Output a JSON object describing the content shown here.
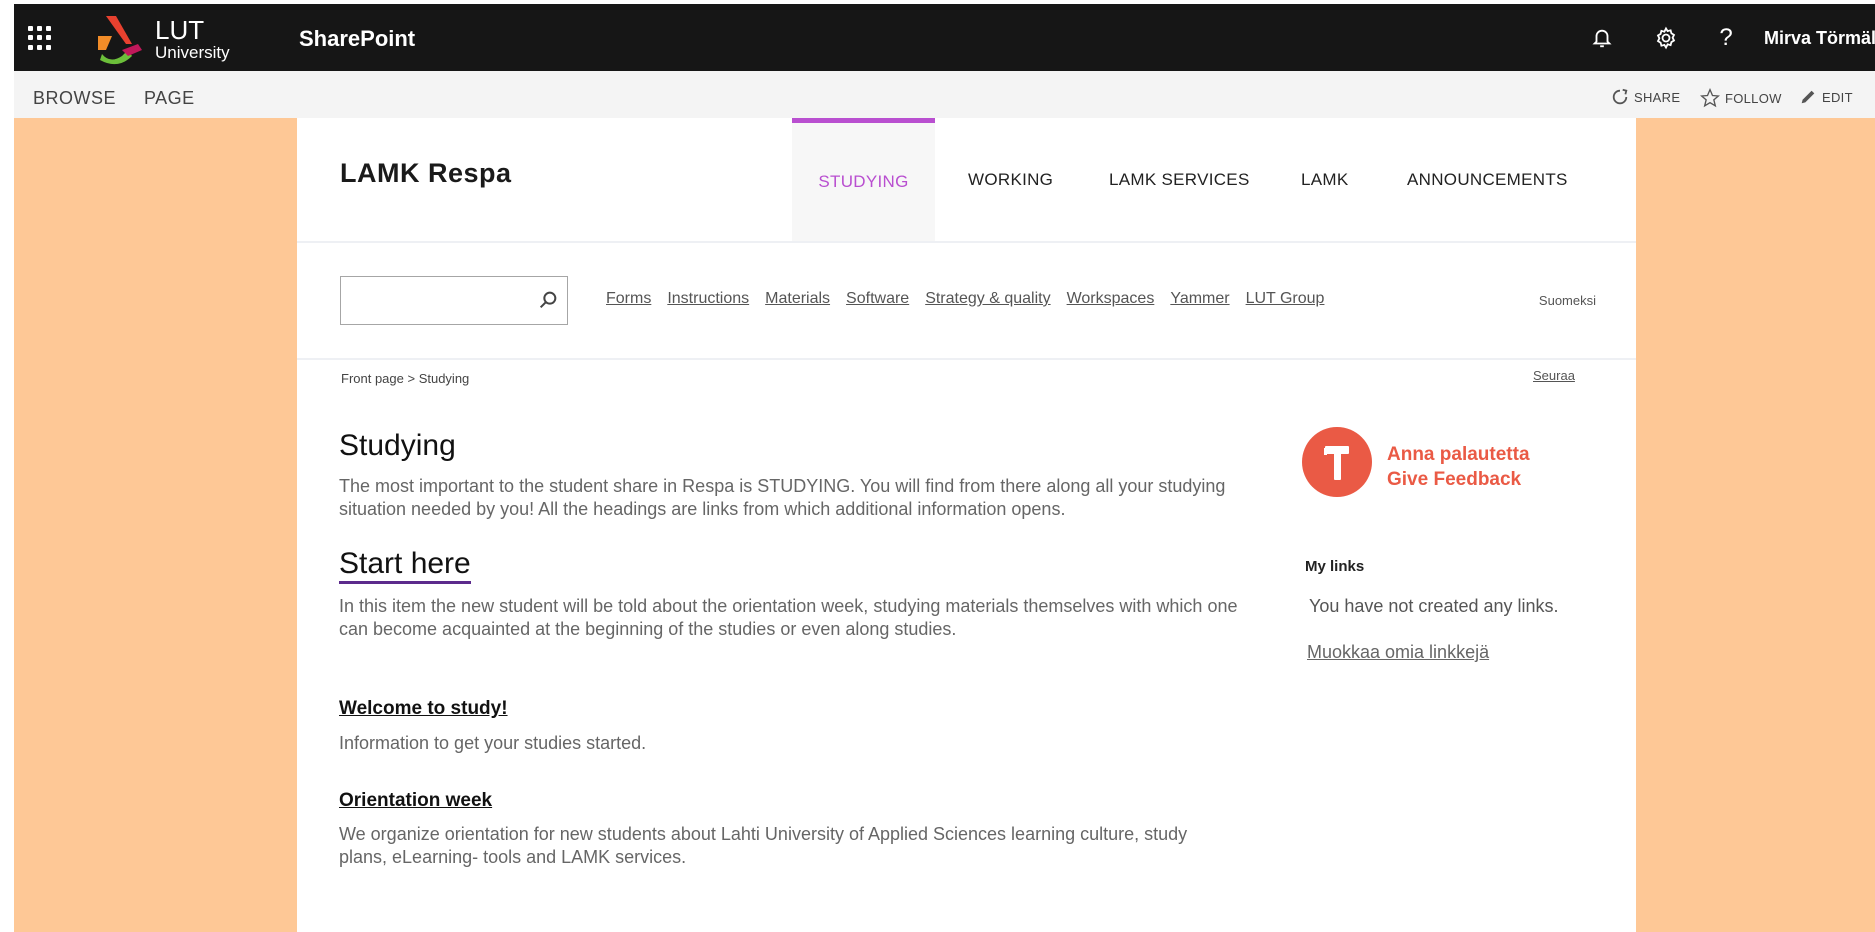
{
  "suite": {
    "org_name": "LUT",
    "org_sub": "University",
    "app_name": "SharePoint",
    "user": "Mirva Törmälä",
    "icons": [
      "waffle-icon",
      "bell-icon",
      "gear-icon",
      "help-icon"
    ],
    "help_glyph": "?"
  },
  "ribbon": {
    "tabs": [
      "BROWSE",
      "PAGE"
    ],
    "actions": [
      "SHARE",
      "FOLLOW",
      "EDIT"
    ]
  },
  "site": {
    "title": "LAMK Respa",
    "nav": [
      "STUDYING",
      "WORKING",
      "LAMK SERVICES",
      "LAMK",
      "ANNOUNCEMENTS"
    ],
    "active_nav": "STUDYING",
    "search": {
      "value": "",
      "placeholder": ""
    },
    "quick_links": [
      "Forms",
      "Instructions",
      "Materials",
      "Software",
      "Strategy & quality",
      "Workspaces",
      "Yammer",
      "LUT Group"
    ],
    "language": "Suomeksi",
    "breadcrumb": "Front page > Studying",
    "follow": "Seuraa"
  },
  "content": {
    "heading": "Studying",
    "intro": "The most important to the student share in Respa is STUDYING. You will find from there along all your studying situation needed by you! All the headings are links from which additional information opens.",
    "start_heading": "Start here",
    "start_text": "In this item the new student will be told about the orientation week, studying materials themselves with which one can become acquainted at the beginning of the studies or even along studies.",
    "sections": [
      {
        "title": "Welcome to study! ",
        "text": "Information to get your studies started."
      },
      {
        "title": "Orientation week",
        "text": "We organize orientation for new students about Lahti University of Applied Sciences learning culture, study plans, eLearning- tools and LAMK services."
      }
    ]
  },
  "sidebar": {
    "feedback_line1": "Anna palautetta",
    "feedback_line2": "Give Feedback",
    "mylinks_title": "My links",
    "mylinks_empty": "You have not created any links.",
    "mylinks_edit": "Muokkaa omia linkkejä"
  },
  "colors": {
    "suitebar": "#161616",
    "accent_purple": "#b94fd0",
    "canvas": "#fec896",
    "feedback": "#ea5a45"
  }
}
